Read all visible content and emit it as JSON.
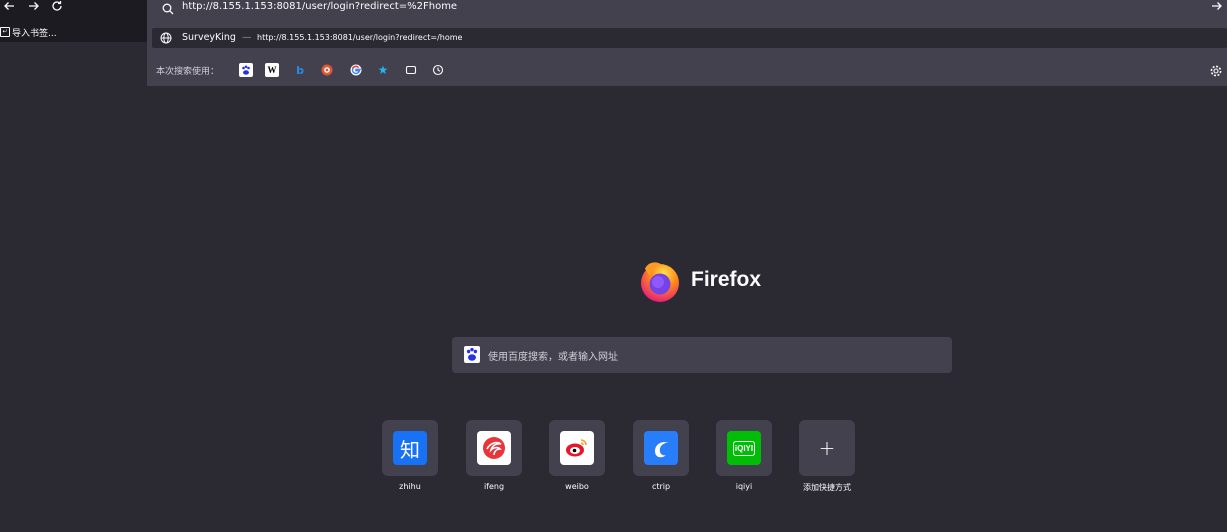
{
  "nav": {
    "back_icon": "arrow-left-icon",
    "forward_icon": "arrow-right-icon",
    "reload_icon": "reload-icon"
  },
  "bookmarks": {
    "import_label": "导入书签..."
  },
  "urlbar": {
    "value": "http://8.155.1.153:8081/user/login?redirect=%2Fhome",
    "go_icon": "arrow-right-icon"
  },
  "suggestion": {
    "title": "SurveyKing",
    "separator": "—",
    "url": "http://8.155.1.153:8081/user/login?redirect=/home"
  },
  "engines": {
    "label": "本次搜索使用：",
    "items": [
      "baidu-icon",
      "wikipedia-icon",
      "bing-icon",
      "duckduckgo-icon",
      "google-icon",
      "bookmarks-star-icon",
      "tabs-icon",
      "history-icon"
    ]
  },
  "newtab": {
    "brand": "Firefox",
    "search_placeholder": "使用百度搜索，或者输入网址"
  },
  "shortcuts": [
    {
      "label": "zhihu",
      "glyph": "知",
      "color": "#1772f6"
    },
    {
      "label": "ifeng",
      "glyph": "",
      "color": "#ffffff"
    },
    {
      "label": "weibo",
      "glyph": "",
      "color": "#ffffff"
    },
    {
      "label": "ctrip",
      "glyph": "",
      "color": "#287dfa"
    },
    {
      "label": "iqiyi",
      "glyph": "iQIYI",
      "color": "#00be06"
    },
    {
      "label": "添加快捷方式",
      "glyph": "+",
      "color": "#42414d"
    }
  ]
}
